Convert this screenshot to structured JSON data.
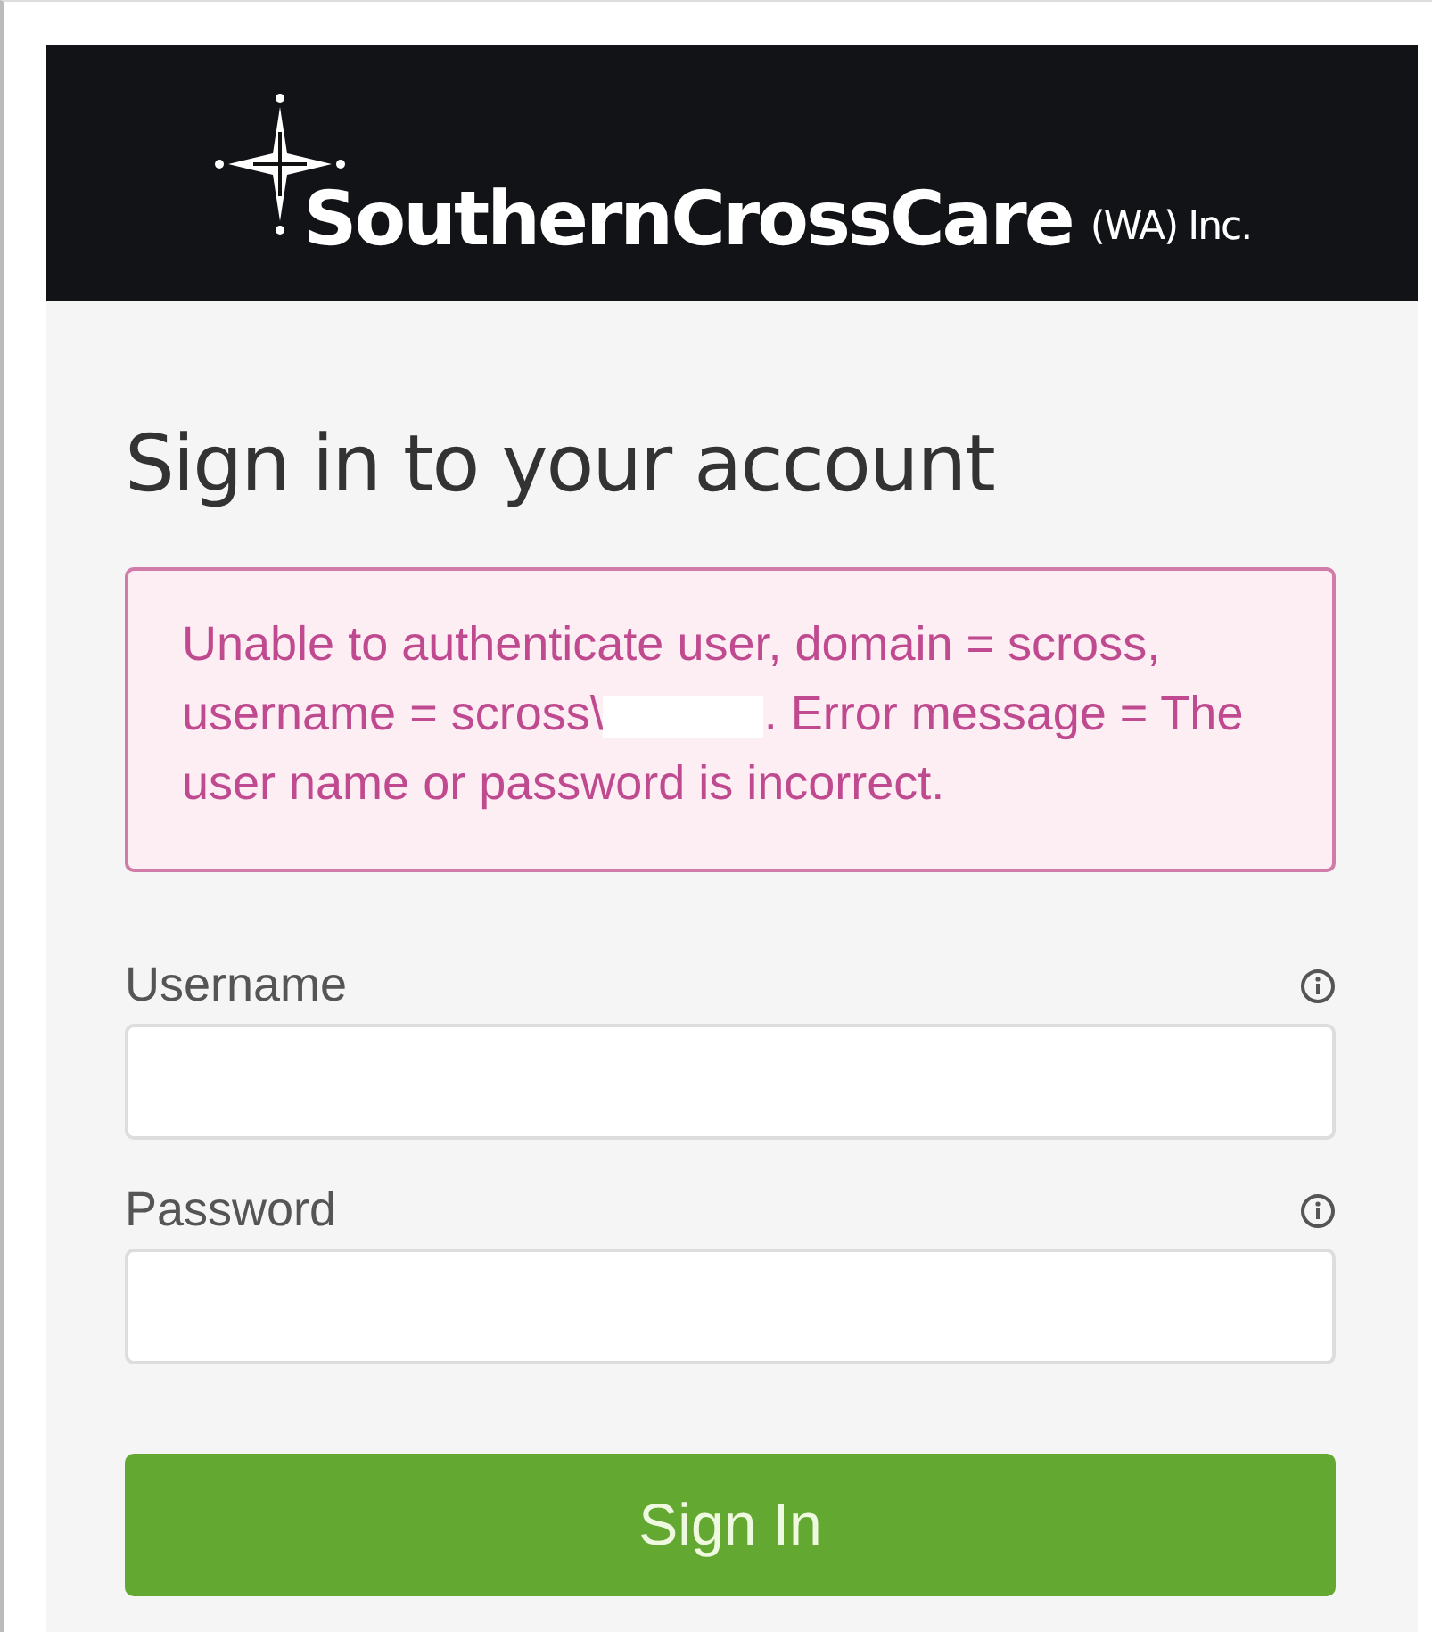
{
  "header": {
    "logo_name": "SouthernCrossCare",
    "logo_suffix": "(WA) Inc."
  },
  "title": "Sign in to your account",
  "error": {
    "parts": [
      "Unable to authenticate user, domain = scross, username = scross\\",
      ". Error message = The user name or password is incorrect."
    ]
  },
  "fields": [
    {
      "label": "Username"
    },
    {
      "label": "Password"
    }
  ],
  "button": "Sign In"
}
